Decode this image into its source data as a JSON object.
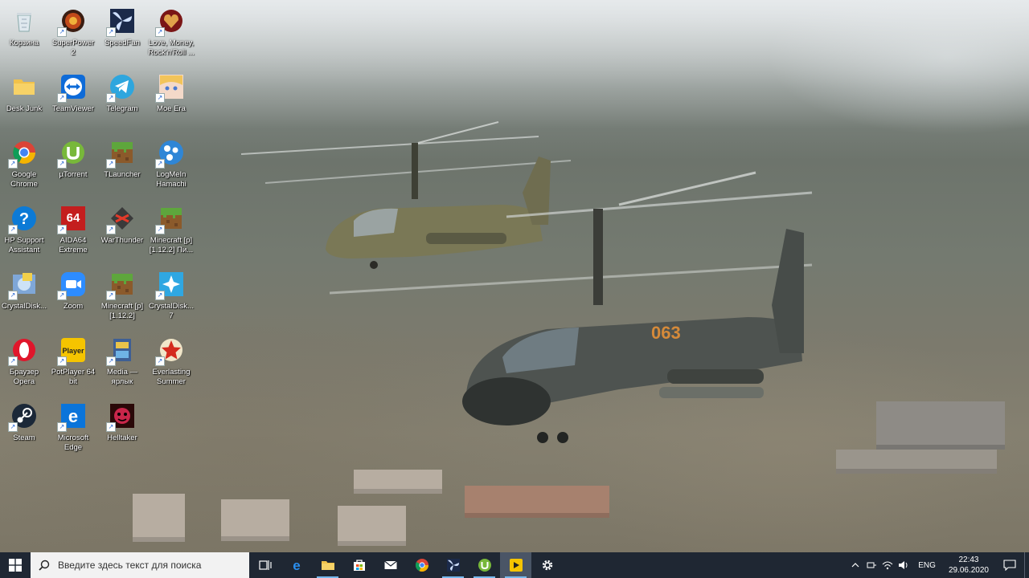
{
  "desktop": {
    "icons": [
      {
        "label": "Корзина",
        "icon": "recycle-bin-icon"
      },
      {
        "label": "SuperPower 2",
        "icon": "superpower-icon"
      },
      {
        "label": "SpeedFan",
        "icon": "speedfan-icon"
      },
      {
        "label": "Love, Money, Rock'n'Roll ...",
        "icon": "heart-badge-icon"
      },
      {
        "label": "Desk Junk",
        "icon": "folder-icon"
      },
      {
        "label": "TeamViewer",
        "icon": "teamviewer-icon"
      },
      {
        "label": "Telegram",
        "icon": "telegram-icon"
      },
      {
        "label": "Moe Era",
        "icon": "anime-girl-icon"
      },
      {
        "label": "Google Chrome",
        "icon": "chrome-icon"
      },
      {
        "label": "µTorrent",
        "icon": "utorrent-icon"
      },
      {
        "label": "TLauncher",
        "icon": "grass-block-icon"
      },
      {
        "label": "LogMeIn Hamachi",
        "icon": "hamachi-icon"
      },
      {
        "label": "HP Support Assistant",
        "icon": "help-icon"
      },
      {
        "label": "AIDA64 Extreme",
        "icon": "aida64-icon"
      },
      {
        "label": "WarThunder",
        "icon": "warthunder-icon"
      },
      {
        "label": "Minecraft [р] [1.12.2] Пи...",
        "icon": "grass-block-icon"
      },
      {
        "label": "CrystalDisk...",
        "icon": "crystaldisk-info-icon"
      },
      {
        "label": "Zoom",
        "icon": "zoom-icon"
      },
      {
        "label": "Minecraft [р] [1.12.2]",
        "icon": "grass-block-icon"
      },
      {
        "label": "CrystalDisk... 7",
        "icon": "crystaldisk-mark-icon"
      },
      {
        "label": "Браузер Opera",
        "icon": "opera-icon"
      },
      {
        "label": "PotPlayer 64 bit",
        "icon": "potplayer-icon"
      },
      {
        "label": "Media — ярлык",
        "icon": "media-icon"
      },
      {
        "label": "Everlasting Summer",
        "icon": "star-badge-icon"
      },
      {
        "label": "Steam",
        "icon": "steam-icon"
      },
      {
        "label": "Microsoft Edge",
        "icon": "edge-icon"
      },
      {
        "label": "Helltaker",
        "icon": "helltaker-icon"
      }
    ]
  },
  "taskbar": {
    "search_placeholder": "Введите здесь текст для поиска",
    "pinned": [
      {
        "name": "task-view",
        "icon": "task-view-icon"
      },
      {
        "name": "edge",
        "icon": "edge-icon"
      },
      {
        "name": "file-explorer",
        "icon": "folder-icon"
      },
      {
        "name": "store",
        "icon": "store-icon"
      },
      {
        "name": "mail",
        "icon": "mail-icon"
      },
      {
        "name": "chrome",
        "icon": "chrome-icon"
      },
      {
        "name": "speedfan",
        "icon": "speedfan-icon"
      },
      {
        "name": "utorrent",
        "icon": "utorrent-icon"
      },
      {
        "name": "potplayer",
        "icon": "potplayer-icon"
      },
      {
        "name": "settings",
        "icon": "gear-icon"
      }
    ],
    "tray": {
      "language": "ENG",
      "time": "22:43",
      "date": "29.06.2020"
    }
  },
  "colors": {
    "taskbar": "#1f2733",
    "search_bg": "#f2f2f2",
    "running_indicator": "#76b9ed"
  }
}
